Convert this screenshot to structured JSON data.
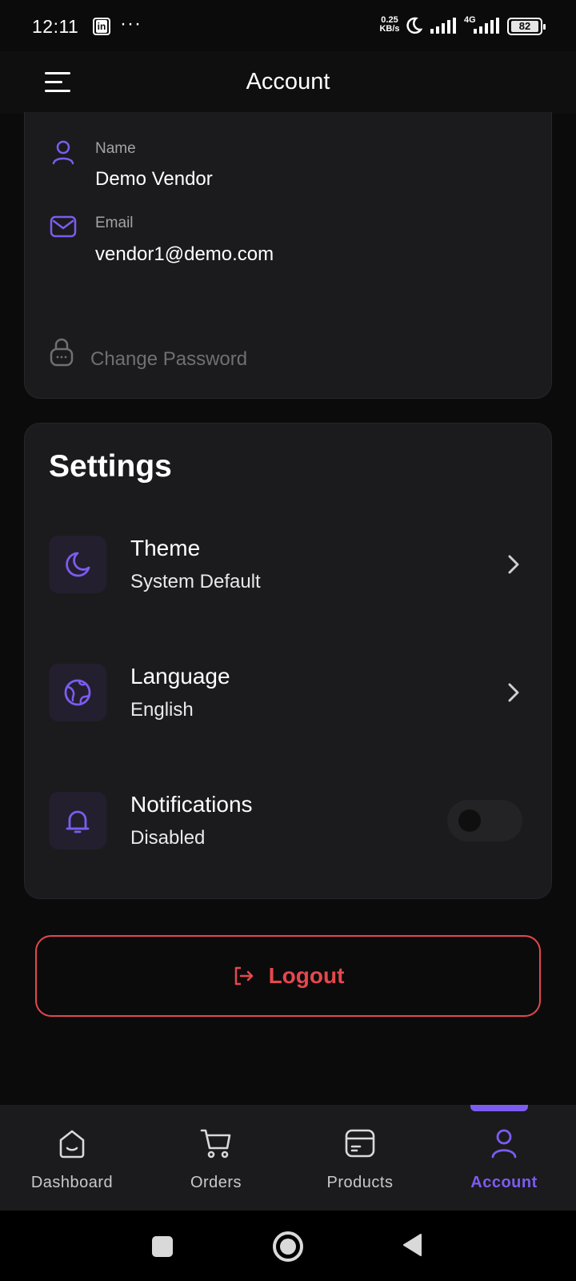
{
  "status_bar": {
    "time": "12:11",
    "app_icon": "in",
    "more": "···",
    "speed_value": "0.25",
    "speed_unit": "KB/s",
    "network": "4G",
    "battery": "82"
  },
  "app_bar": {
    "title": "Account"
  },
  "profile": {
    "name_label": "Name",
    "name_value": "Demo Vendor",
    "email_label": "Email",
    "email_value": "vendor1@demo.com",
    "change_password": "Change Password"
  },
  "settings": {
    "title": "Settings",
    "items": [
      {
        "title": "Theme",
        "subtitle": "System Default",
        "icon": "moon-icon",
        "control": "chevron"
      },
      {
        "title": "Language",
        "subtitle": "English",
        "icon": "globe-icon",
        "control": "chevron"
      },
      {
        "title": "Notifications",
        "subtitle": "Disabled",
        "icon": "bell-icon",
        "control": "toggle",
        "toggle_on": false
      }
    ]
  },
  "logout": {
    "label": "Logout"
  },
  "bottom_nav": {
    "items": [
      {
        "label": "Dashboard",
        "icon": "home-icon",
        "active": false
      },
      {
        "label": "Orders",
        "icon": "cart-icon",
        "active": false
      },
      {
        "label": "Products",
        "icon": "box-icon",
        "active": false
      },
      {
        "label": "Account",
        "icon": "user-icon",
        "active": true
      }
    ]
  },
  "colors": {
    "accent": "#7c5cf0",
    "danger": "#e5484d",
    "background": "#0b0b0c",
    "card": "#1b1b1d"
  }
}
